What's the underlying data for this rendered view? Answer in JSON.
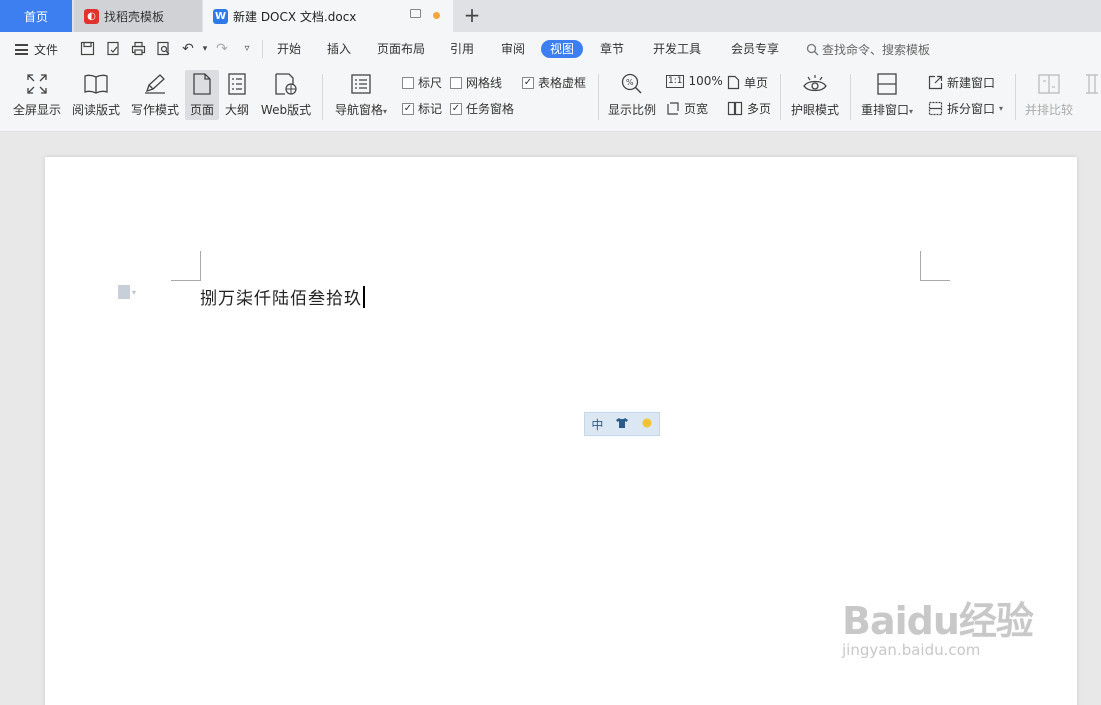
{
  "tabs": {
    "home": "首页",
    "template": "找稻壳模板",
    "document": "新建 DOCX 文档.docx"
  },
  "menu": {
    "file": "文件",
    "items": [
      "开始",
      "插入",
      "页面布局",
      "引用",
      "审阅",
      "视图",
      "章节",
      "开发工具",
      "会员专享"
    ],
    "active": "视图",
    "search_placeholder": "查找命令、搜索模板"
  },
  "toolbar": {
    "fullscreen": "全屏显示",
    "reading": "阅读版式",
    "writing": "写作模式",
    "page": "页面",
    "outline": "大纲",
    "web": "Web版式",
    "nav_pane": "导航窗格",
    "ruler": "标尺",
    "gridlines": "网格线",
    "table_gridlines": "表格虚框",
    "marks": "标记",
    "task_pane": "任务窗格",
    "zoom": "显示比例",
    "zoom_100": "100%",
    "page_width": "页宽",
    "single_page": "单页",
    "multi_page": "多页",
    "eye_protect": "护眼模式",
    "rearrange": "重排窗口",
    "new_window": "新建窗口",
    "split_window": "拆分窗口",
    "side_by_side": "并排比较"
  },
  "checkboxes": {
    "ruler": false,
    "gridlines": false,
    "table_gridlines": true,
    "marks": true,
    "task_pane": true
  },
  "document": {
    "text": "捌万柒仟陆佰叁拾玖"
  },
  "ime": {
    "mode": "中"
  },
  "watermark": {
    "main": "Baidu经验",
    "sub": "jingyan.baidu.com"
  },
  "colors": {
    "accent": "#3d7ff0",
    "tab_dot": "#f2a63b"
  }
}
